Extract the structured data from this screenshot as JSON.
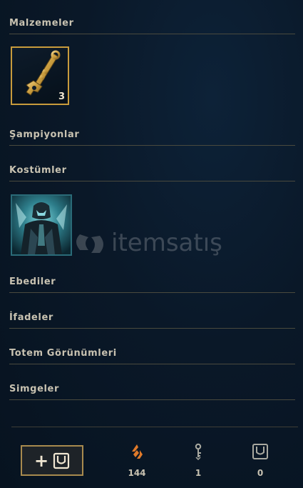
{
  "sections": {
    "materials": "Malzemeler",
    "champions": "Şampiyonlar",
    "skins": "Kostümler",
    "eternals": "Ebediler",
    "emotes": "İfadeler",
    "ward_skins": "Totem Görünümleri",
    "icons": "Simgeler"
  },
  "materials_items": [
    {
      "icon": "hextech-key-icon",
      "count": "3"
    }
  ],
  "skin_items": [
    {
      "icon": "skin-thumbnail"
    }
  ],
  "watermark": {
    "text": "itemsatış"
  },
  "footer": {
    "add_button_label": "+",
    "currencies": [
      {
        "icon": "orange-essence-icon",
        "value": "144",
        "color": "#e07a2a"
      },
      {
        "icon": "key-fragment-icon",
        "value": "1",
        "color": "#a9a9a0"
      },
      {
        "icon": "chest-icon",
        "value": "0",
        "color": "#a9a9a0"
      }
    ]
  },
  "colors": {
    "gold": "#c89b3c",
    "title": "#c8c2b1",
    "rule": "#4a4a3e"
  }
}
